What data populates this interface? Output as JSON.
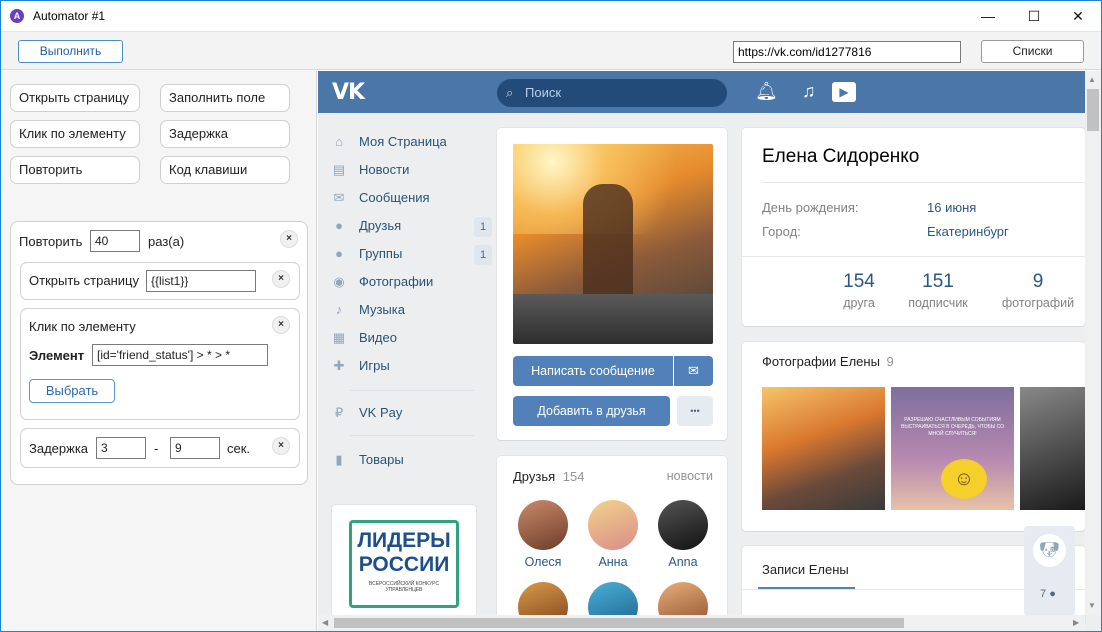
{
  "window": {
    "title": "Automator #1",
    "icon": "automator-app-icon",
    "controls": {
      "minimize": "—",
      "maximize": "☐",
      "close": "✕"
    }
  },
  "toolbar": {
    "run_label": "Выполнить",
    "url_value": "https://vk.com/id1277816",
    "lists_label": "Списки"
  },
  "palette": {
    "open_page": "Открыть страницу",
    "fill_field": "Заполнить поле",
    "click_element": "Клик по элементу",
    "delay": "Задержка",
    "repeat": "Повторить",
    "key_code": "Код клавиши"
  },
  "script": {
    "repeat_label": "Повторить",
    "repeat_count": "40",
    "repeat_suffix": "раз(а)",
    "open_page_label": "Открыть страницу",
    "open_page_value": "{{list1}}",
    "click_label": "Клик по элементу",
    "element_label": "Элемент",
    "element_value": "[id='friend_status'] > * > *",
    "select_label": "Выбрать",
    "delay_label": "Задержка",
    "delay_from": "3",
    "delay_dash": "-",
    "delay_to": "9",
    "delay_unit": "сек.",
    "remove_glyph": "×"
  },
  "vk": {
    "logo": "VK",
    "search_placeholder": "Поиск",
    "nav": [
      {
        "label": "Моя Страница",
        "icon": "home-icon",
        "glyph": "⌂"
      },
      {
        "label": "Новости",
        "icon": "news-icon",
        "glyph": "▤"
      },
      {
        "label": "Сообщения",
        "icon": "messages-icon",
        "glyph": "✉"
      },
      {
        "label": "Друзья",
        "icon": "friends-icon",
        "glyph": "●",
        "badge": "1"
      },
      {
        "label": "Группы",
        "icon": "groups-icon",
        "glyph": "●",
        "badge": "1"
      },
      {
        "label": "Фотографии",
        "icon": "photos-icon",
        "glyph": "◉"
      },
      {
        "label": "Музыка",
        "icon": "music-icon",
        "glyph": "♪"
      },
      {
        "label": "Видео",
        "icon": "video-icon",
        "glyph": "▦"
      },
      {
        "label": "Игры",
        "icon": "games-icon",
        "glyph": "✚"
      },
      {
        "label": "VK Pay",
        "icon": "vkpay-icon",
        "glyph": "₽"
      },
      {
        "label": "Товары",
        "icon": "goods-icon",
        "glyph": "▮"
      }
    ],
    "ad_title": "ЛИДЕРЫ РОССИИ",
    "ad_subtitle": "ВСЕРОССИЙСКИЙ КОНКУРС УПРАВЛЕНЦЕВ",
    "write_message": "Написать сообщение",
    "add_friend": "Добавить в друзья",
    "gift_glyph": "✉",
    "more_glyph": "•••",
    "profile_name": "Елена Сидоренко",
    "birthday_label": "День рождения:",
    "birthday_value": "16 июня",
    "city_label": "Город:",
    "city_value": "Екатеринбург",
    "counters": [
      {
        "num": "154",
        "label": "друга"
      },
      {
        "num": "151",
        "label": "подписчик"
      },
      {
        "num": "9",
        "label": "фотографий"
      }
    ],
    "photos_title": "Фотографии Елены",
    "photos_count": "9",
    "photo2_text": "РАЗРЕШАЮ СЧАСТЛИВЫМ СОБЫТИЯМ ВЫСТРАИВАТЬСЯ В ОЧЕРЕДЬ, ЧТОБЫ СО МНОЙ СЛУЧИТЬСЯ!",
    "friends_title": "Друзья",
    "friends_count": "154",
    "friends_news": "новости",
    "friends": [
      "Олеся",
      "Анна",
      "Anna"
    ],
    "wall_tab": "Записи Елены",
    "fab_count": "7"
  },
  "colors": {
    "vk_blue": "#4a76a8",
    "vk_button": "#5181b8",
    "link": "#2a5885",
    "accent_border": "#1883d7"
  }
}
